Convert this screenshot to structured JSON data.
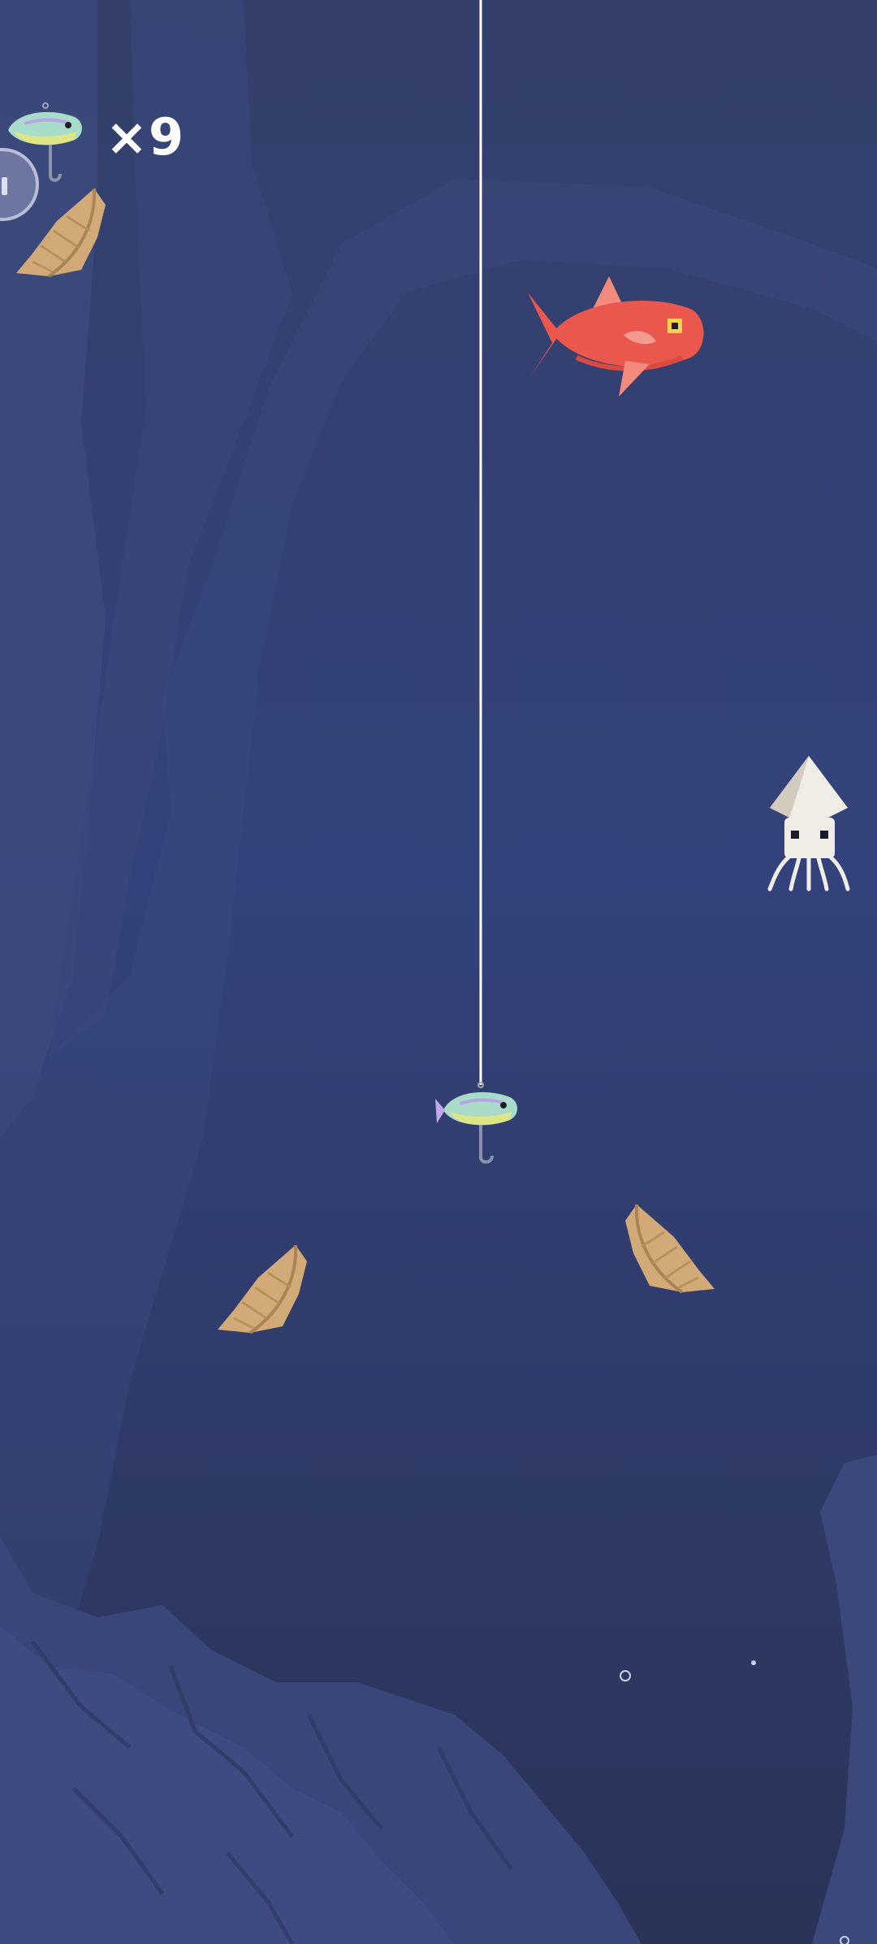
{
  "hud": {
    "lure_count_text": "×9",
    "lure_icon": "lure-fish-icon",
    "pause_icon": "pause-icon"
  },
  "scene": {
    "background": "underwater-cave",
    "colors": {
      "water_deep": "#2c365f",
      "water_mid": "#33427a",
      "cave_wall": "#3d4a80",
      "line": "#ffffff",
      "red_fish": "#e9574d",
      "shell": "#d2aa78",
      "squid": "#f0ece6"
    },
    "creatures": [
      {
        "kind": "red-fish"
      },
      {
        "kind": "squid"
      },
      {
        "kind": "conch-shell"
      },
      {
        "kind": "conch-shell"
      },
      {
        "kind": "conch-shell"
      }
    ]
  }
}
